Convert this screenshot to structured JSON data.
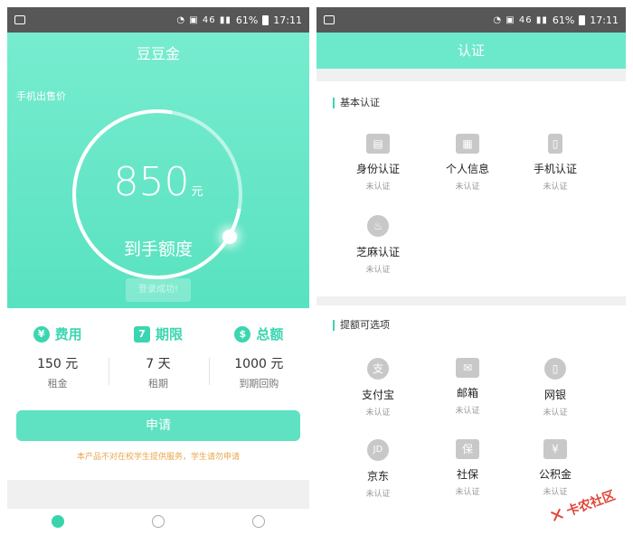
{
  "status": {
    "signal_text": "46",
    "battery": "61%",
    "time": "17:11"
  },
  "left": {
    "title": "豆豆金",
    "subtitle": "手机出售价",
    "amount": "850",
    "amount_unit": "元",
    "amount_label": "到手额度",
    "faint_button": "登录成功!",
    "stats": [
      {
        "icon": "¥",
        "title": "费用",
        "value": "150 元",
        "label": "租金"
      },
      {
        "icon": "7",
        "title": "期限",
        "value": "7 天",
        "label": "租期"
      },
      {
        "icon": "$",
        "title": "总额",
        "value": "1000 元",
        "label": "到期回购"
      }
    ],
    "apply_label": "申请",
    "notice": "本产品不对在校学生提供服务，学生请勿申请"
  },
  "right": {
    "header": "认证",
    "basic_title": "基本认证",
    "basic_items": [
      {
        "name": "身份认证",
        "status": "未认证"
      },
      {
        "name": "个人信息",
        "status": "未认证"
      },
      {
        "name": "手机认证",
        "status": "未认证"
      },
      {
        "name": "芝麻认证",
        "status": "未认证"
      }
    ],
    "extra_title": "提额可选项",
    "extra_items": [
      {
        "name": "支付宝",
        "status": "未认证",
        "glyph": "支"
      },
      {
        "name": "邮箱",
        "status": "未认证",
        "glyph": "✉"
      },
      {
        "name": "网银",
        "status": "未认证",
        "glyph": "▯"
      },
      {
        "name": "京东",
        "status": "未认证",
        "glyph": "JD"
      },
      {
        "name": "社保",
        "status": "未认证",
        "glyph": "保"
      },
      {
        "name": "公积金",
        "status": "未认证",
        "glyph": "¥"
      }
    ]
  },
  "watermark": "卡农社区"
}
